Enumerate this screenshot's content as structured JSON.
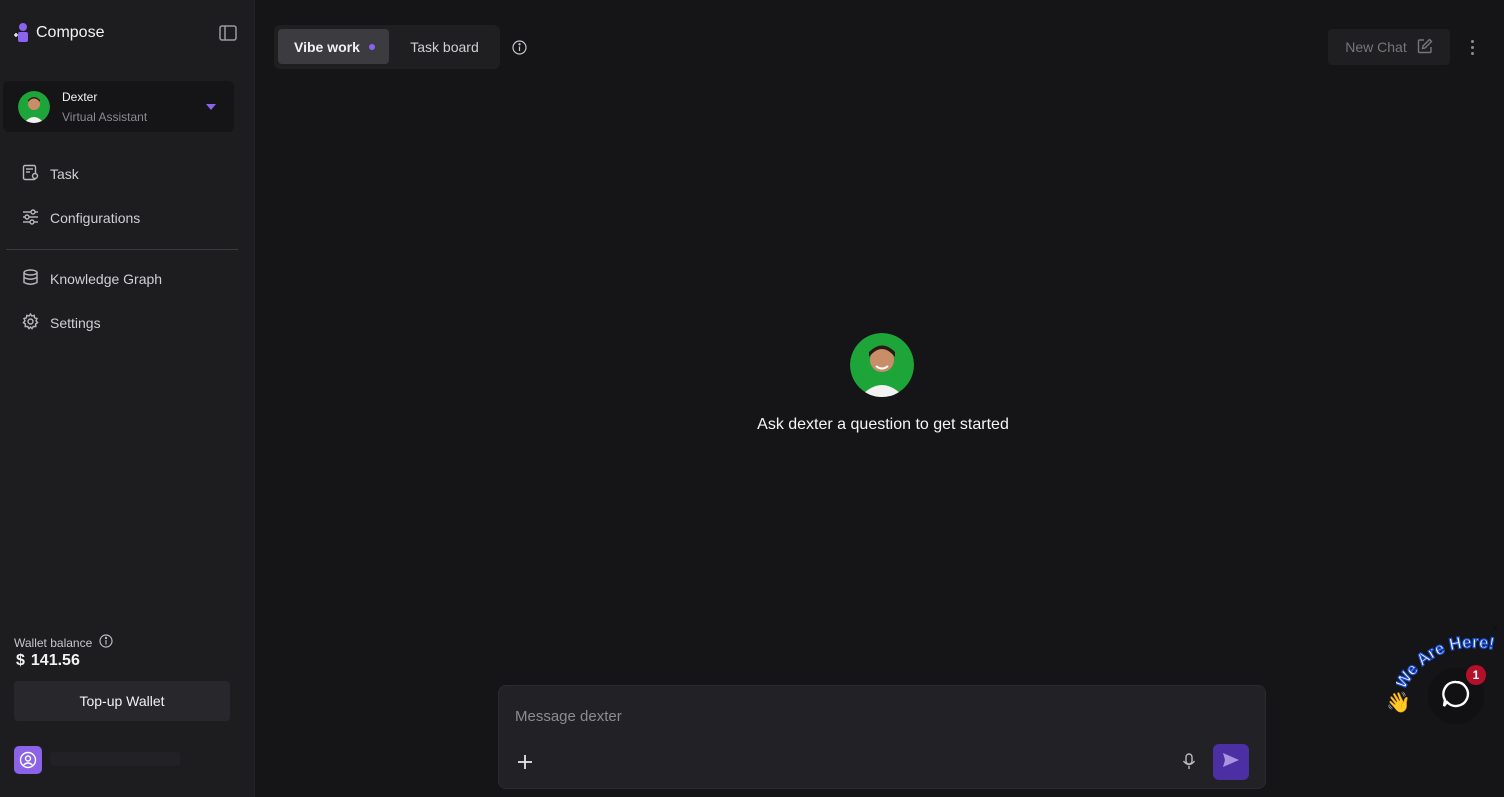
{
  "app": {
    "name": "Compose"
  },
  "agent": {
    "name": "Dexter",
    "role": "Virtual Assistant"
  },
  "nav": {
    "items": [
      {
        "label": "Task",
        "icon": "task-icon"
      },
      {
        "label": "Configurations",
        "icon": "sliders-icon"
      },
      {
        "label": "Knowledge Graph",
        "icon": "database-icon"
      },
      {
        "label": "Settings",
        "icon": "gear-icon"
      }
    ]
  },
  "wallet": {
    "label": "Wallet balance",
    "currency": "$",
    "amount": "141.56",
    "topup_label": "Top-up Wallet"
  },
  "tabs": [
    {
      "label": "Vibe work",
      "active": true
    },
    {
      "label": "Task board",
      "active": false
    }
  ],
  "header": {
    "new_chat_label": "New Chat"
  },
  "main": {
    "prompt": "Ask dexter a question to get started"
  },
  "composer": {
    "placeholder": "Message dexter"
  },
  "widget": {
    "text": "We Are Here!",
    "badge_count": "1"
  },
  "colors": {
    "accent": "#8a63f0",
    "send": "#4b2fa3",
    "background": "#151517",
    "sidebar": "#1d1d20"
  }
}
